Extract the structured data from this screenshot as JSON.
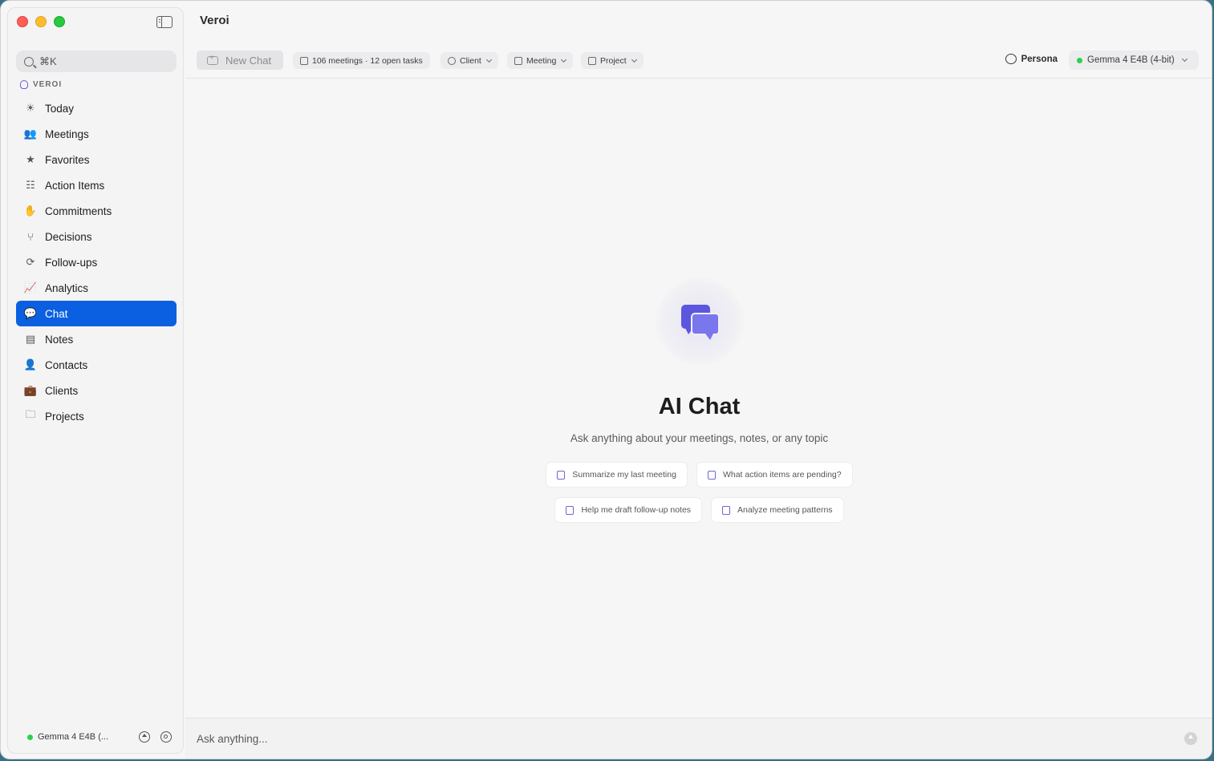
{
  "window": {
    "title": "Veroi"
  },
  "sidebar": {
    "search_placeholder": "⌘K",
    "section_title": "VEROI",
    "items": [
      {
        "label": "Today",
        "icon": "sun-icon"
      },
      {
        "label": "Meetings",
        "icon": "people-icon"
      },
      {
        "label": "Favorites",
        "icon": "star-icon"
      },
      {
        "label": "Action Items",
        "icon": "checklist-icon"
      },
      {
        "label": "Commitments",
        "icon": "hand-icon"
      },
      {
        "label": "Decisions",
        "icon": "branch-icon"
      },
      {
        "label": "Follow-ups",
        "icon": "arrow-circle-icon"
      },
      {
        "label": "Analytics",
        "icon": "chart-line-icon"
      },
      {
        "label": "Chat",
        "icon": "chat-bubbles-icon",
        "active": true
      },
      {
        "label": "Notes",
        "icon": "note-icon"
      },
      {
        "label": "Contacts",
        "icon": "contact-card-icon"
      },
      {
        "label": "Clients",
        "icon": "briefcase-icon"
      },
      {
        "label": "Projects",
        "icon": "folder-icon"
      }
    ],
    "footer": {
      "model_label": "Gemma 4 E4B (...",
      "status_color": "#2fcf4a"
    }
  },
  "toolbar": {
    "new_chat_label": "New Chat",
    "stats_label": "106 meetings · 12 open tasks",
    "filters": {
      "client": "Client",
      "meeting": "Meeting",
      "project": "Project"
    },
    "persona_label": "Persona",
    "model_label": "Gemma 4 E4B (4-bit)"
  },
  "hero": {
    "title": "AI Chat",
    "subtitle": "Ask anything about your meetings, notes, or any topic",
    "suggestions": [
      {
        "label": "Summarize my last meeting",
        "icon": "document-icon"
      },
      {
        "label": "What action items are pending?",
        "icon": "checklist-icon"
      },
      {
        "label": "Help me draft follow-up notes",
        "icon": "envelope-icon"
      },
      {
        "label": "Analyze meeting patterns",
        "icon": "bar-chart-icon"
      }
    ]
  },
  "composer": {
    "placeholder": "Ask anything..."
  },
  "colors": {
    "accent": "#0a60e0",
    "brand": "#5b57de"
  }
}
